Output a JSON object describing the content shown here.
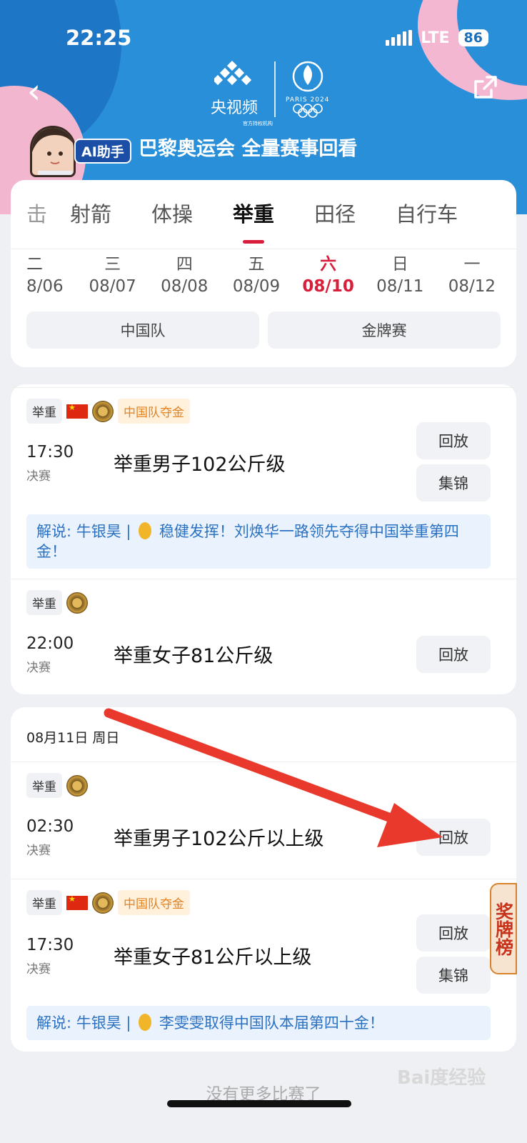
{
  "status": {
    "time": "22:25",
    "network": "LTE",
    "battery": "86"
  },
  "header": {
    "cctv_label": "央视频",
    "paris_label": "PARIS 2024",
    "org_caption": "官方持权机构",
    "ai_tag": "AI助手",
    "banner": "巴黎奥运会 全量赛事回看"
  },
  "sport_tabs": [
    {
      "label": "击"
    },
    {
      "label": "射箭"
    },
    {
      "label": "体操"
    },
    {
      "label": "举重",
      "active": true
    },
    {
      "label": "田径"
    },
    {
      "label": "自行车"
    }
  ],
  "days": [
    {
      "weekday": "二",
      "date": "8/06"
    },
    {
      "weekday": "三",
      "date": "08/07"
    },
    {
      "weekday": "四",
      "date": "08/08"
    },
    {
      "weekday": "五",
      "date": "08/09"
    },
    {
      "weekday": "六",
      "date": "08/10",
      "active": true
    },
    {
      "weekday": "日",
      "date": "08/11"
    },
    {
      "weekday": "一",
      "date": "08/12"
    }
  ],
  "filters": [
    "中国队",
    "金牌赛"
  ],
  "section2": {
    "date_header": "08月11日 周日"
  },
  "events": [
    {
      "sport": "举重",
      "china_gold_tag": "中国队夺金",
      "time": "17:30",
      "stage": "决赛",
      "title": "举重男子102公斤级",
      "replay": "回放",
      "highlight": "集锦",
      "commentary": "解说: 牛银昊 |",
      "comment_text": "稳健发挥！刘焕华一路领先夺得中国举重第四金！"
    },
    {
      "sport": "举重",
      "time": "22:00",
      "stage": "决赛",
      "title": "举重女子81公斤级",
      "replay": "回放"
    },
    {
      "sport": "举重",
      "time": "02:30",
      "stage": "决赛",
      "title": "举重男子102公斤以上级",
      "replay": "回放"
    },
    {
      "sport": "举重",
      "china_gold_tag": "中国队夺金",
      "time": "17:30",
      "stage": "决赛",
      "title": "举重女子81公斤以上级",
      "replay": "回放",
      "highlight": "集锦",
      "commentary": "解说: 牛银昊 |",
      "comment_text": "李雯雯取得中国队本届第四十金！"
    }
  ],
  "footer": {
    "no_more": "没有更多比赛了",
    "medal_tab": "奖牌榜",
    "watermark": "Bai度经验"
  },
  "colors": {
    "brand_blue": "#2a8fd9",
    "accent_red": "#d81e3a",
    "annotation_arrow": "#e8392c"
  }
}
